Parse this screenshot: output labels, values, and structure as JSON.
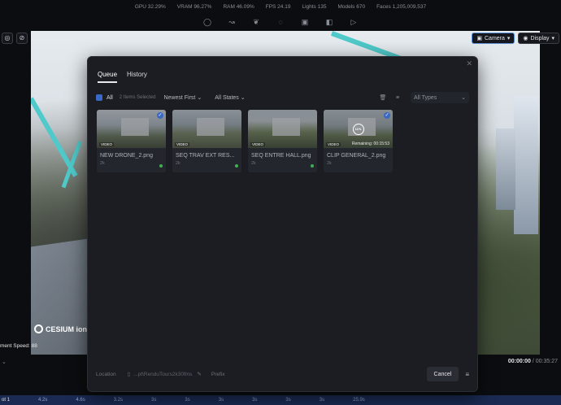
{
  "stats": {
    "gpu": "GPU 32.29%",
    "vram": "VRAM 96.27%",
    "ram": "RAM 46.09%",
    "fps": "FPS 24.19",
    "lights": "Lights 135",
    "models": "Models 670",
    "faces": "Faces 1,205,009,537"
  },
  "toolbar_icons": [
    "lightbulb-icon",
    "node-icon",
    "leaf-icon",
    "flame-icon",
    "image-icon",
    "cube-icon",
    "play-icon"
  ],
  "viewport": {
    "camera_label": "Camera",
    "display_label": "Display",
    "logo_text": "CESIUM ion",
    "speed_text": "ment Speed: 88"
  },
  "timeline": {
    "current": "00:00:00",
    "separator": " / ",
    "total": "00:35:27",
    "shot_label": "ot 1",
    "ticks": [
      "4.2s",
      "4.6s",
      "3.2s",
      "3s",
      "3s",
      "3s",
      "3s",
      "3s",
      "3s",
      "25.9s"
    ]
  },
  "dialog": {
    "tabs": [
      "Queue",
      "History"
    ],
    "active_tab": "Queue",
    "select_all": "All",
    "selected_count": "2 Items Selected",
    "sort": "Newest First",
    "state_filter": "All States",
    "type_filter": "All Types",
    "items": [
      {
        "name": "NEW DRONE_2.png",
        "res": "2k",
        "badge": "VIDEO",
        "checked": true,
        "status": "done",
        "remaining": "",
        "progress": ""
      },
      {
        "name": "SEQ TRAV EXT RES...",
        "res": "2k",
        "badge": "VIDEO",
        "checked": false,
        "status": "done",
        "remaining": "",
        "progress": ""
      },
      {
        "name": "SEQ ENTRE HALL.png",
        "res": "2k",
        "badge": "VIDEO",
        "checked": false,
        "status": "done",
        "remaining": "",
        "progress": ""
      },
      {
        "name": "CLIP GENERAL_2.png",
        "res": "2k",
        "badge": "VIDEO",
        "checked": true,
        "status": "rendering",
        "remaining": "Remaining: 00:15:53",
        "progress": "11%"
      }
    ],
    "footer": {
      "location_label": "Location",
      "path": "...pt\\RenduTours2k30fms",
      "prefix_label": "Prefix",
      "cancel_label": "Cancel"
    }
  },
  "colors": {
    "accent": "#3a68c4",
    "success": "#3fae55",
    "cyan_path": "#4fc9c9"
  }
}
